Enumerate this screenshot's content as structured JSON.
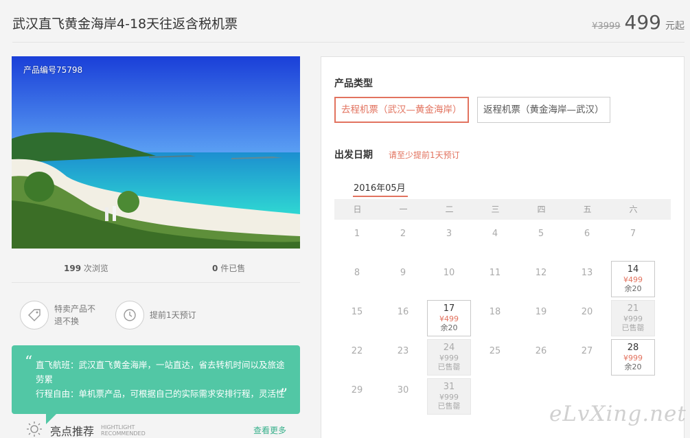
{
  "header": {
    "title": "武汉直飞黄金海岸4-18天往返含税机票",
    "old_price": "¥3999",
    "price": "499",
    "price_unit": "元起"
  },
  "left": {
    "product_no": "产品编号75798",
    "views_count": "199",
    "views_label": "次浏览",
    "sold_count": "0",
    "sold_label": "件已售",
    "badge1": "特卖产品不退不换",
    "badge2": "提前1天预订",
    "quote_line1": "直飞航班：武汉直飞黄金海岸，一站直达，省去转机时间以及旅途劳累",
    "quote_line2": "行程自由：单机票产品，可根据自己的实际需求安排行程，灵活性",
    "highlight_title": "亮点推荐",
    "highlight_en1": "HIGHTLIGHT",
    "highlight_en2": "RECOMMENDED",
    "more": "查看更多"
  },
  "panel": {
    "type_label": "产品类型",
    "type_options": [
      "去程机票（武汉—黄金海岸）",
      "返程机票（黄金海岸—武汉）"
    ],
    "date_label": "出发日期",
    "date_hint": "请至少提前1天预订",
    "month": "2016年05月",
    "weekdays": [
      "日",
      "一",
      "二",
      "三",
      "四",
      "五",
      "六"
    ]
  },
  "calendar": [
    {
      "day": "1"
    },
    {
      "day": "2"
    },
    {
      "day": "3"
    },
    {
      "day": "4"
    },
    {
      "day": "5"
    },
    {
      "day": "6"
    },
    {
      "day": "7"
    },
    {
      "day": "8"
    },
    {
      "day": "9"
    },
    {
      "day": "10"
    },
    {
      "day": "11"
    },
    {
      "day": "12"
    },
    {
      "day": "13"
    },
    {
      "day": "14",
      "status": "avail",
      "price": "¥499",
      "remain": "余20"
    },
    {
      "day": "15"
    },
    {
      "day": "16"
    },
    {
      "day": "17",
      "status": "avail",
      "price": "¥499",
      "remain": "余20"
    },
    {
      "day": "18"
    },
    {
      "day": "19"
    },
    {
      "day": "20"
    },
    {
      "day": "21",
      "status": "sold",
      "price": "¥999",
      "remain": "已售罄"
    },
    {
      "day": "22"
    },
    {
      "day": "23"
    },
    {
      "day": "24",
      "status": "sold",
      "price": "¥999",
      "remain": "已售罄"
    },
    {
      "day": "25"
    },
    {
      "day": "26"
    },
    {
      "day": "27"
    },
    {
      "day": "28",
      "status": "avail",
      "price": "¥999",
      "remain": "余20"
    },
    {
      "day": "29"
    },
    {
      "day": "30"
    },
    {
      "day": "31",
      "status": "sold",
      "price": "¥999",
      "remain": "已售罄"
    }
  ],
  "watermark": "eLvXing.net",
  "colors": {
    "accent": "#e2725e",
    "green": "#52c7a5"
  }
}
